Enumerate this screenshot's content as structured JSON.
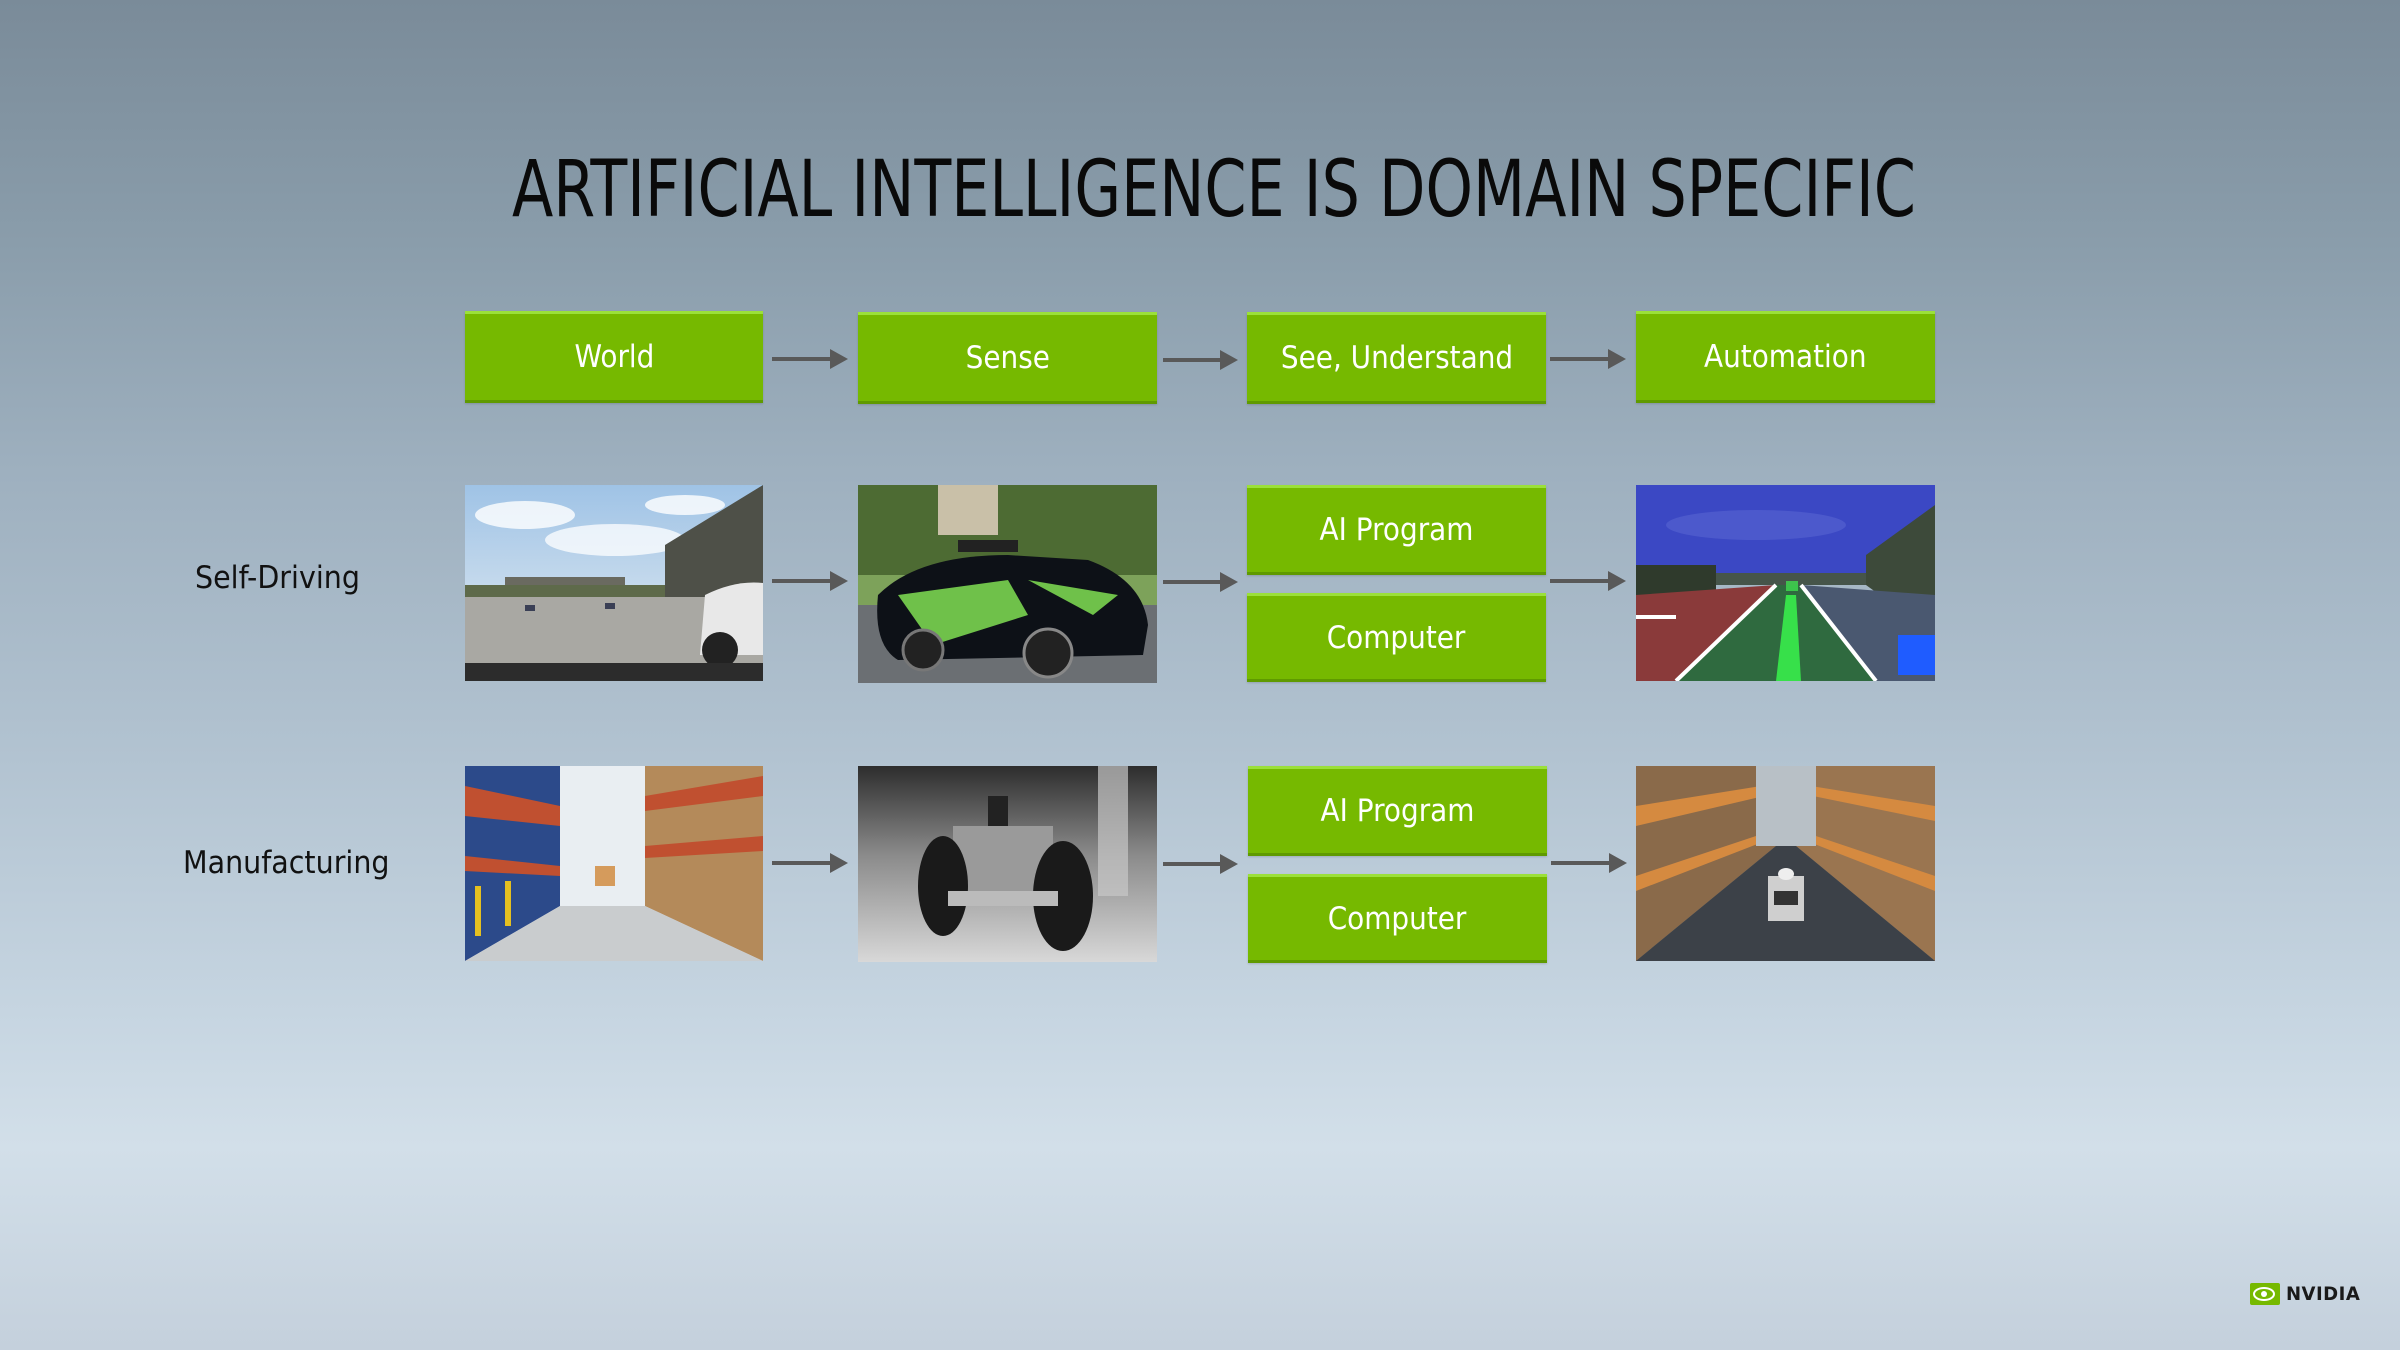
{
  "slide": {
    "title": "ARTIFICIAL INTELLIGENCE IS DOMAIN SPECIFIC",
    "accent_color": "#76b900",
    "arrow_color": "#595959"
  },
  "header_row": [
    {
      "label": "World"
    },
    {
      "label": "Sense"
    },
    {
      "label": "See, Understand"
    },
    {
      "label": "Automation"
    }
  ],
  "rows": [
    {
      "label": "Self-Driving",
      "world_image": "highway-road-view-photo",
      "sense_image": "autonomous-test-car-photo",
      "understand_boxes": [
        "AI Program",
        "Computer"
      ],
      "automation_image": "lane-detection-visualization"
    },
    {
      "label": "Manufacturing",
      "world_image": "warehouse-aisle-photo",
      "sense_image": "wheeled-robot-photo",
      "understand_boxes": [
        "AI Program",
        "Computer"
      ],
      "automation_image": "robot-in-warehouse-aisle"
    }
  ],
  "footer": {
    "logo_text": "NVIDIA",
    "logo_icon": "nvidia-eye-icon"
  }
}
